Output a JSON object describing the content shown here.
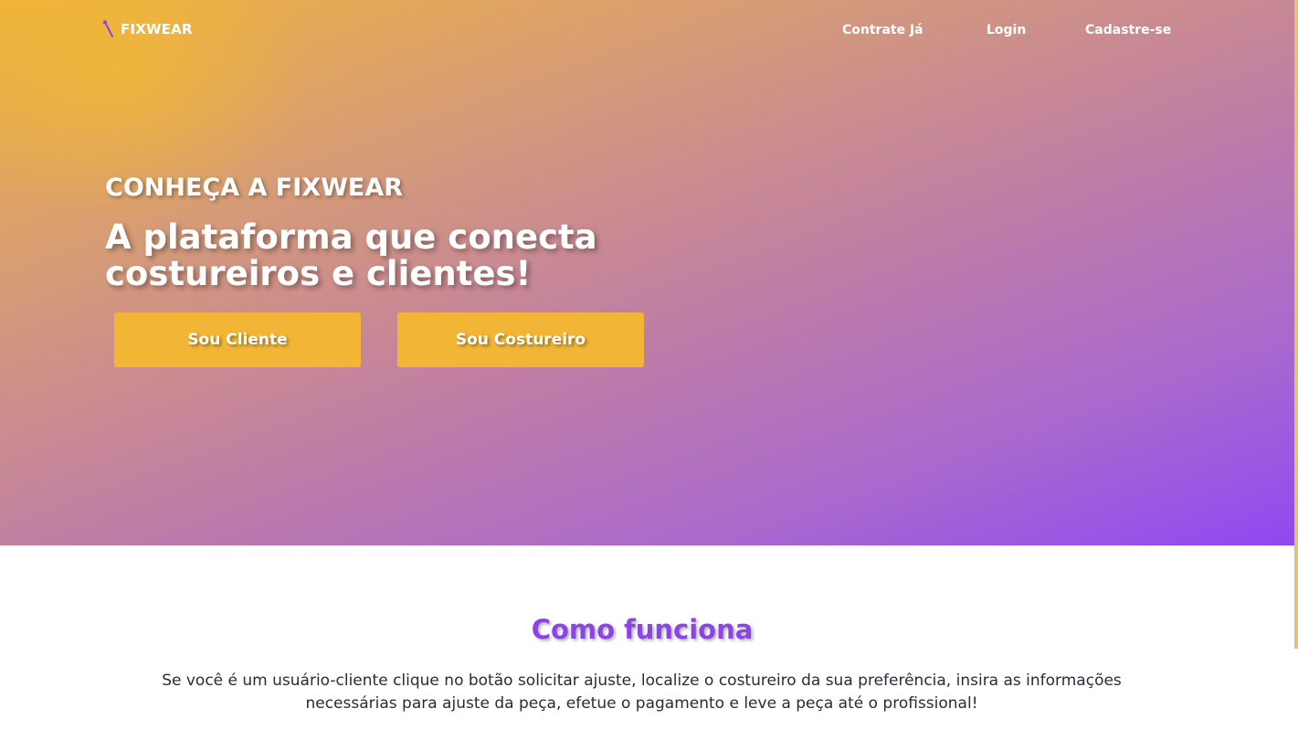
{
  "brand": {
    "name": "FIXWEAR",
    "logo_icon": "needle-icon",
    "accent_color": "#8d44e6",
    "button_color": "#f2b535"
  },
  "nav": {
    "items": [
      {
        "label": "Contrate Já"
      },
      {
        "label": "Login"
      },
      {
        "label": "Cadastre-se"
      }
    ]
  },
  "hero": {
    "eyebrow": "CONHEÇA A FIXWEAR",
    "headline": "A plataforma que conecta costureiros e clientes!",
    "buttons": [
      {
        "label": "Sou Cliente"
      },
      {
        "label": "Sou Costureiro"
      }
    ]
  },
  "how_it_works": {
    "title": "Como funciona",
    "text": "Se você é um usuário-cliente clique no botão solicitar ajuste, localize o costureiro da sua preferência, insira as informações necessárias para ajuste da peça, efetue o pagamento e leve a peça até o profissional!"
  }
}
